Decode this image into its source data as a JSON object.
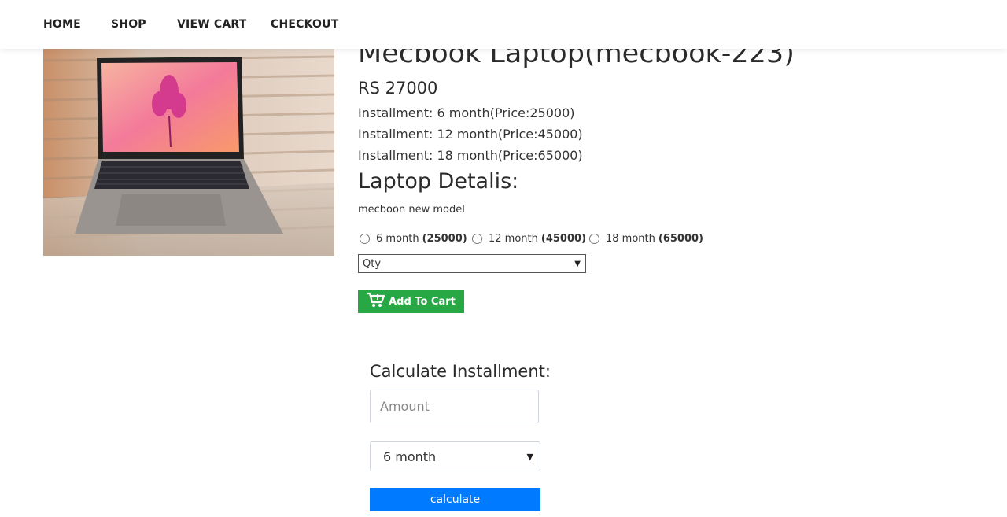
{
  "nav": {
    "items": [
      "HOME",
      "SHOP",
      "VIEW CART",
      "CHECKOUT"
    ]
  },
  "product": {
    "title": "Mecbook Laptop(mecbook-223)",
    "price": "RS 27000",
    "installments": [
      "Installment: 6 month(Price:25000)",
      "Installment: 12 month(Price:45000)",
      "Installment: 18 month(Price:65000)"
    ],
    "details_heading": "Laptop Detalis:",
    "description": "mecboon new model",
    "image_icon": "laptop-photo"
  },
  "options": [
    {
      "label": "6 month",
      "price": "(25000)"
    },
    {
      "label": "12 month",
      "price": "(45000)"
    },
    {
      "label": "18 month",
      "price": "(65000)"
    }
  ],
  "qty": {
    "selected": "Qty"
  },
  "cart": {
    "button_label": "Add To Cart",
    "icon": "cart-plus-icon"
  },
  "calculator": {
    "heading": "Calculate Installment:",
    "amount_placeholder": "Amount",
    "months_selected": "6 month",
    "button_label": "calculate"
  },
  "colors": {
    "add_to_cart": "#28a745",
    "calculate": "#007bff"
  }
}
